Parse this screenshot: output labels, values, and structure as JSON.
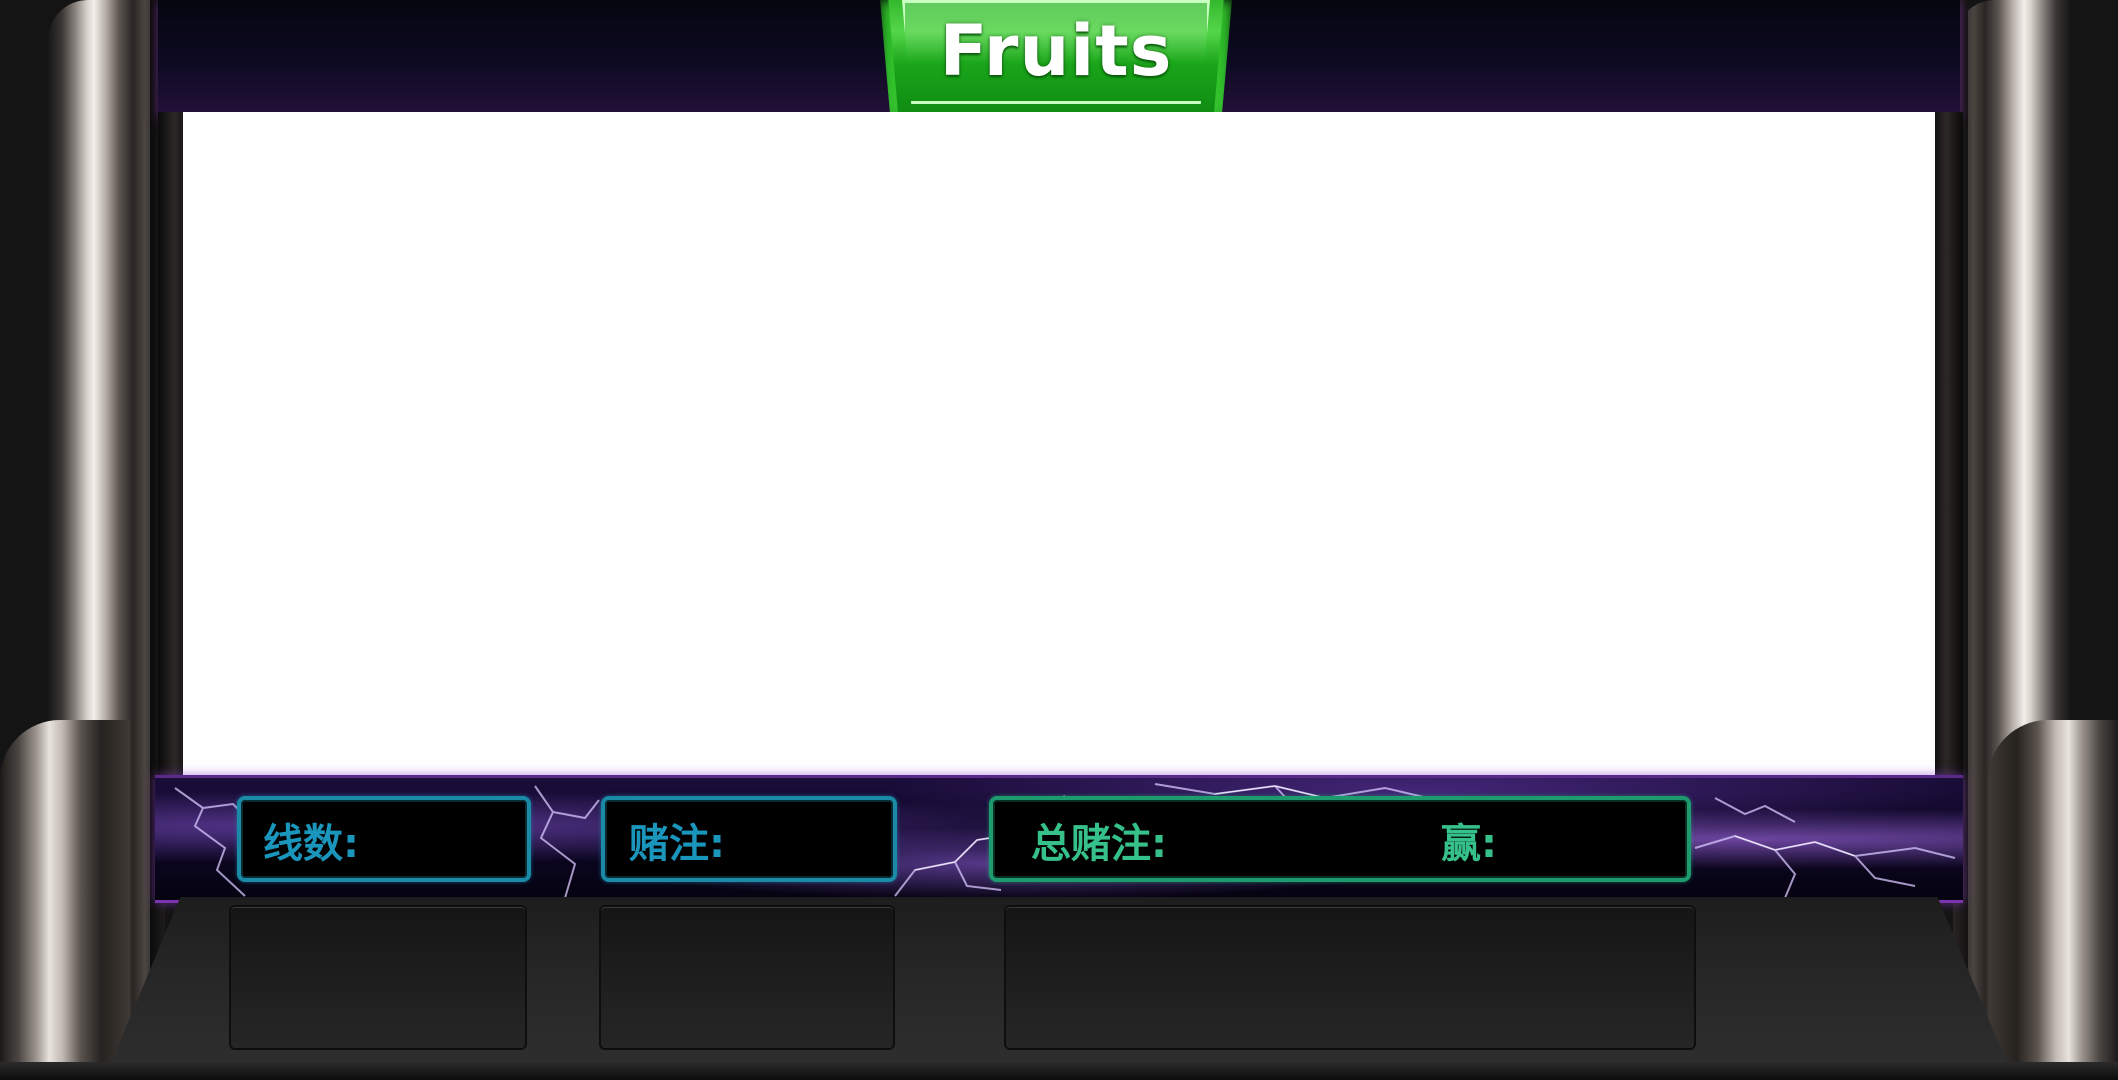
{
  "header": {
    "game_title": "Fruits"
  },
  "info_bar": {
    "lines_label": "线数:",
    "bet_label": "赌注:",
    "total_bet_label": "总赌注:",
    "win_label": "赢:"
  },
  "colors": {
    "title_badge": "#1aa51a",
    "info_cyan": "#1a95bb",
    "info_green": "#36c08a",
    "info_bar_border": "#7a34b0"
  }
}
